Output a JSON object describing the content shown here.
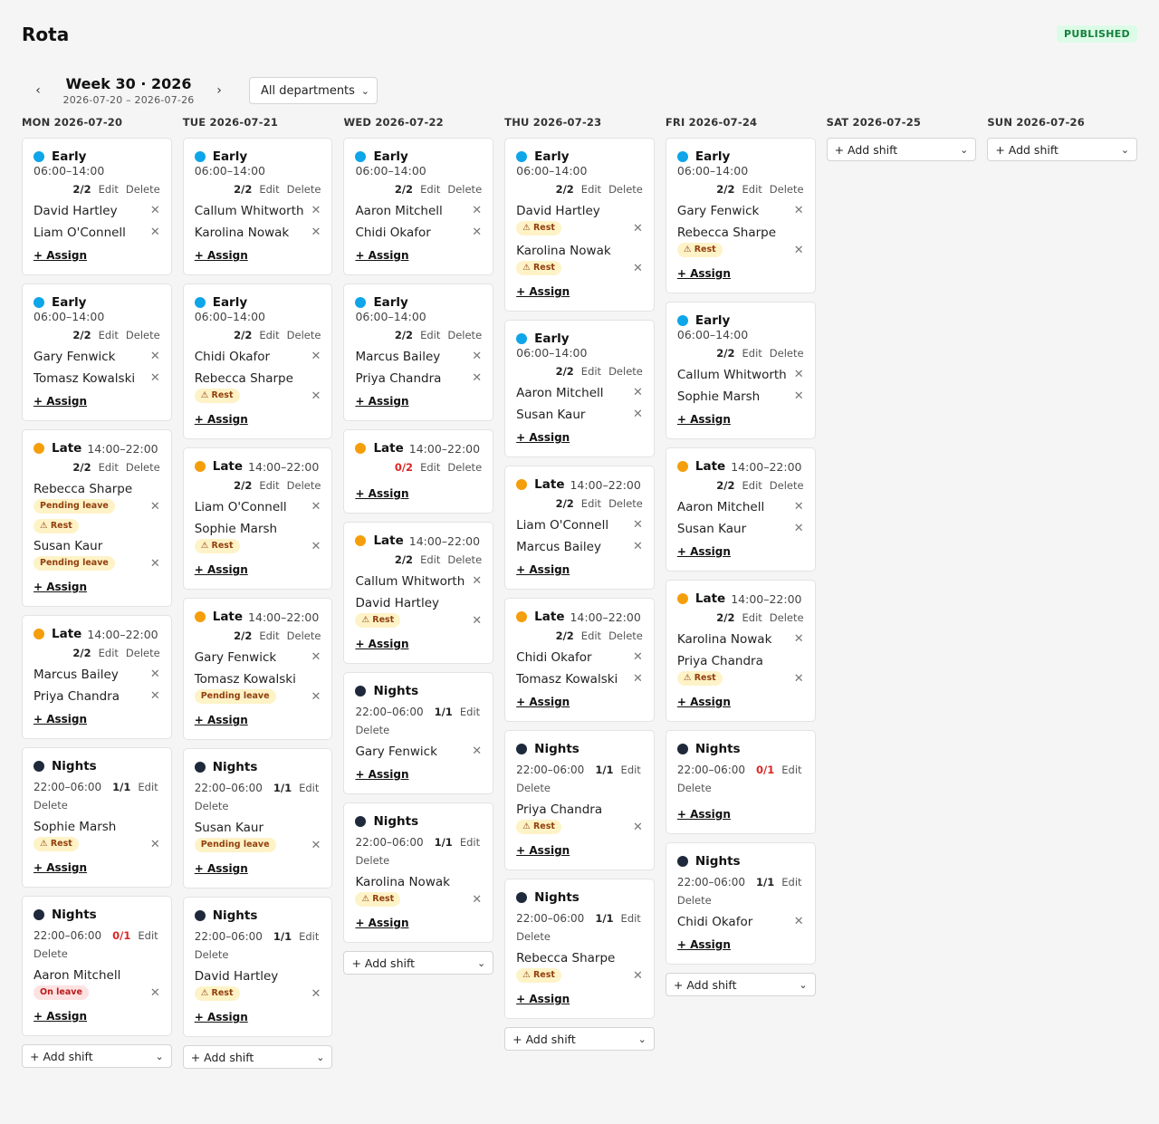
{
  "header": {
    "title": "Rota",
    "status": "PUBLISHED"
  },
  "week": {
    "title": "Week 30 · 2026",
    "range": "2026-07-20 – 2026-07-26",
    "prev": "‹",
    "next": "›"
  },
  "filter": {
    "department": "All departments"
  },
  "labels": {
    "edit": "Edit",
    "delete": "Delete",
    "assign": "+ Assign",
    "add_shift": "+ Add shift",
    "remove": "✕"
  },
  "days": [
    {
      "label": "MON 2026-07-20",
      "shifts": [
        {
          "type": "early",
          "name": "Early",
          "time": "06:00–14:00",
          "coverage": "2/2",
          "under": false,
          "assignees": [
            {
              "name": "David Hartley",
              "badges": []
            },
            {
              "name": "Liam O'Connell",
              "badges": []
            }
          ]
        },
        {
          "type": "early",
          "name": "Early",
          "time": "06:00–14:00",
          "coverage": "2/2",
          "under": false,
          "assignees": [
            {
              "name": "Gary Fenwick",
              "badges": []
            },
            {
              "name": "Tomasz Kowalski",
              "badges": []
            }
          ]
        },
        {
          "type": "late",
          "name": "Late",
          "time": "14:00–22:00",
          "coverage": "2/2",
          "under": false,
          "assignees": [
            {
              "name": "Rebecca Sharpe",
              "badges": [
                {
                  "kind": "pending",
                  "text": "Pending leave"
                },
                {
                  "kind": "rest",
                  "text": "⚠ Rest"
                }
              ]
            },
            {
              "name": "Susan Kaur",
              "badges": [
                {
                  "kind": "pending",
                  "text": "Pending leave"
                }
              ]
            }
          ]
        },
        {
          "type": "late",
          "name": "Late",
          "time": "14:00–22:00",
          "coverage": "2/2",
          "under": false,
          "assignees": [
            {
              "name": "Marcus Bailey",
              "badges": []
            },
            {
              "name": "Priya Chandra",
              "badges": []
            }
          ]
        },
        {
          "type": "nights",
          "name": "Nights",
          "time": "22:00–06:00",
          "coverage": "1/1",
          "under": false,
          "assignees": [
            {
              "name": "Sophie Marsh",
              "badges": [
                {
                  "kind": "rest",
                  "text": "⚠ Rest"
                }
              ]
            }
          ]
        },
        {
          "type": "nights",
          "name": "Nights",
          "time": "22:00–06:00",
          "coverage": "0/1",
          "under": true,
          "assignees": [
            {
              "name": "Aaron Mitchell",
              "badges": [
                {
                  "kind": "onleave",
                  "text": "On leave"
                }
              ]
            }
          ]
        }
      ]
    },
    {
      "label": "TUE 2026-07-21",
      "shifts": [
        {
          "type": "early",
          "name": "Early",
          "time": "06:00–14:00",
          "coverage": "2/2",
          "under": false,
          "assignees": [
            {
              "name": "Callum Whitworth",
              "badges": []
            },
            {
              "name": "Karolina Nowak",
              "badges": []
            }
          ]
        },
        {
          "type": "early",
          "name": "Early",
          "time": "06:00–14:00",
          "coverage": "2/2",
          "under": false,
          "assignees": [
            {
              "name": "Chidi Okafor",
              "badges": []
            },
            {
              "name": "Rebecca Sharpe",
              "badges": [
                {
                  "kind": "rest",
                  "text": "⚠ Rest"
                }
              ]
            }
          ]
        },
        {
          "type": "late",
          "name": "Late",
          "time": "14:00–22:00",
          "coverage": "2/2",
          "under": false,
          "assignees": [
            {
              "name": "Liam O'Connell",
              "badges": []
            },
            {
              "name": "Sophie Marsh",
              "badges": [
                {
                  "kind": "rest",
                  "text": "⚠ Rest"
                }
              ]
            }
          ]
        },
        {
          "type": "late",
          "name": "Late",
          "time": "14:00–22:00",
          "coverage": "2/2",
          "under": false,
          "assignees": [
            {
              "name": "Gary Fenwick",
              "badges": []
            },
            {
              "name": "Tomasz Kowalski",
              "badges": [
                {
                  "kind": "pending",
                  "text": "Pending leave"
                }
              ]
            }
          ]
        },
        {
          "type": "nights",
          "name": "Nights",
          "time": "22:00–06:00",
          "coverage": "1/1",
          "under": false,
          "assignees": [
            {
              "name": "Susan Kaur",
              "badges": [
                {
                  "kind": "pending",
                  "text": "Pending leave"
                }
              ]
            }
          ]
        },
        {
          "type": "nights",
          "name": "Nights",
          "time": "22:00–06:00",
          "coverage": "1/1",
          "under": false,
          "assignees": [
            {
              "name": "David Hartley",
              "badges": [
                {
                  "kind": "rest",
                  "text": "⚠ Rest"
                }
              ]
            }
          ]
        }
      ]
    },
    {
      "label": "WED 2026-07-22",
      "shifts": [
        {
          "type": "early",
          "name": "Early",
          "time": "06:00–14:00",
          "coverage": "2/2",
          "under": false,
          "assignees": [
            {
              "name": "Aaron Mitchell",
              "badges": []
            },
            {
              "name": "Chidi Okafor",
              "badges": []
            }
          ]
        },
        {
          "type": "early",
          "name": "Early",
          "time": "06:00–14:00",
          "coverage": "2/2",
          "under": false,
          "assignees": [
            {
              "name": "Marcus Bailey",
              "badges": []
            },
            {
              "name": "Priya Chandra",
              "badges": []
            }
          ]
        },
        {
          "type": "late",
          "name": "Late",
          "time": "14:00–22:00",
          "coverage": "0/2",
          "under": true,
          "assignees": []
        },
        {
          "type": "late",
          "name": "Late",
          "time": "14:00–22:00",
          "coverage": "2/2",
          "under": false,
          "assignees": [
            {
              "name": "Callum Whitworth",
              "badges": []
            },
            {
              "name": "David Hartley",
              "badges": [
                {
                  "kind": "rest",
                  "text": "⚠ Rest"
                }
              ]
            }
          ]
        },
        {
          "type": "nights",
          "name": "Nights",
          "time": "22:00–06:00",
          "coverage": "1/1",
          "under": false,
          "assignees": [
            {
              "name": "Gary Fenwick",
              "badges": []
            }
          ]
        },
        {
          "type": "nights",
          "name": "Nights",
          "time": "22:00–06:00",
          "coverage": "1/1",
          "under": false,
          "assignees": [
            {
              "name": "Karolina Nowak",
              "badges": [
                {
                  "kind": "rest",
                  "text": "⚠ Rest"
                }
              ]
            }
          ]
        }
      ]
    },
    {
      "label": "THU 2026-07-23",
      "shifts": [
        {
          "type": "early",
          "name": "Early",
          "time": "06:00–14:00",
          "coverage": "2/2",
          "under": false,
          "assignees": [
            {
              "name": "David Hartley",
              "badges": [
                {
                  "kind": "rest",
                  "text": "⚠ Rest"
                }
              ]
            },
            {
              "name": "Karolina Nowak",
              "badges": [
                {
                  "kind": "rest",
                  "text": "⚠ Rest"
                }
              ]
            }
          ]
        },
        {
          "type": "early",
          "name": "Early",
          "time": "06:00–14:00",
          "coverage": "2/2",
          "under": false,
          "assignees": [
            {
              "name": "Aaron Mitchell",
              "badges": []
            },
            {
              "name": "Susan Kaur",
              "badges": []
            }
          ]
        },
        {
          "type": "late",
          "name": "Late",
          "time": "14:00–22:00",
          "coverage": "2/2",
          "under": false,
          "assignees": [
            {
              "name": "Liam O'Connell",
              "badges": []
            },
            {
              "name": "Marcus Bailey",
              "badges": []
            }
          ]
        },
        {
          "type": "late",
          "name": "Late",
          "time": "14:00–22:00",
          "coverage": "2/2",
          "under": false,
          "assignees": [
            {
              "name": "Chidi Okafor",
              "badges": []
            },
            {
              "name": "Tomasz Kowalski",
              "badges": []
            }
          ]
        },
        {
          "type": "nights",
          "name": "Nights",
          "time": "22:00–06:00",
          "coverage": "1/1",
          "under": false,
          "assignees": [
            {
              "name": "Priya Chandra",
              "badges": [
                {
                  "kind": "rest",
                  "text": "⚠ Rest"
                }
              ]
            }
          ]
        },
        {
          "type": "nights",
          "name": "Nights",
          "time": "22:00–06:00",
          "coverage": "1/1",
          "under": false,
          "assignees": [
            {
              "name": "Rebecca Sharpe",
              "badges": [
                {
                  "kind": "rest",
                  "text": "⚠ Rest"
                }
              ]
            }
          ]
        }
      ]
    },
    {
      "label": "FRI 2026-07-24",
      "shifts": [
        {
          "type": "early",
          "name": "Early",
          "time": "06:00–14:00",
          "coverage": "2/2",
          "under": false,
          "assignees": [
            {
              "name": "Gary Fenwick",
              "badges": []
            },
            {
              "name": "Rebecca Sharpe",
              "badges": [
                {
                  "kind": "rest",
                  "text": "⚠ Rest"
                }
              ]
            }
          ]
        },
        {
          "type": "early",
          "name": "Early",
          "time": "06:00–14:00",
          "coverage": "2/2",
          "under": false,
          "assignees": [
            {
              "name": "Callum Whitworth",
              "badges": []
            },
            {
              "name": "Sophie Marsh",
              "badges": []
            }
          ]
        },
        {
          "type": "late",
          "name": "Late",
          "time": "14:00–22:00",
          "coverage": "2/2",
          "under": false,
          "assignees": [
            {
              "name": "Aaron Mitchell",
              "badges": []
            },
            {
              "name": "Susan Kaur",
              "badges": []
            }
          ]
        },
        {
          "type": "late",
          "name": "Late",
          "time": "14:00–22:00",
          "coverage": "2/2",
          "under": false,
          "assignees": [
            {
              "name": "Karolina Nowak",
              "badges": []
            },
            {
              "name": "Priya Chandra",
              "badges": [
                {
                  "kind": "rest",
                  "text": "⚠ Rest"
                }
              ]
            }
          ]
        },
        {
          "type": "nights",
          "name": "Nights",
          "time": "22:00–06:00",
          "coverage": "0/1",
          "under": true,
          "assignees": []
        },
        {
          "type": "nights",
          "name": "Nights",
          "time": "22:00–06:00",
          "coverage": "1/1",
          "under": false,
          "assignees": [
            {
              "name": "Chidi Okafor",
              "badges": []
            }
          ]
        }
      ]
    },
    {
      "label": "SAT 2026-07-25",
      "shifts": []
    },
    {
      "label": "SUN 2026-07-26",
      "shifts": []
    }
  ]
}
